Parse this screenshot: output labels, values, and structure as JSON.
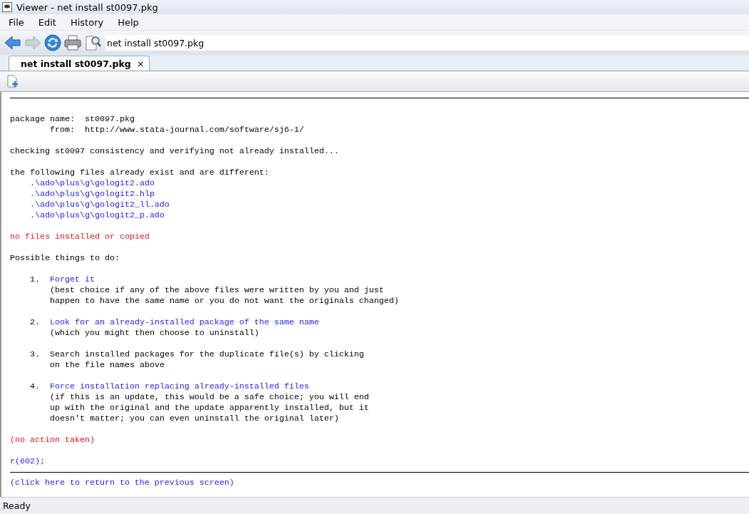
{
  "window": {
    "title": "Viewer - net install st0097.pkg"
  },
  "menu": [
    "File",
    "Edit",
    "History",
    "Help"
  ],
  "toolbar": {
    "address": "net install st0097.pkg"
  },
  "tabs": [
    {
      "label": "net install st0097.pkg",
      "selected": true,
      "close": "×"
    }
  ],
  "output": {
    "package": {
      "name_label": "package name:",
      "name": "st0097.pkg",
      "from_label": "from:",
      "from": "http://www.stata-journal.com/software/sj6-1/"
    },
    "checking": "checking st0097 consistency and verifying not already installed...",
    "conflict": {
      "heading": "the following files already exist and are different:",
      "files": [
        ".\\ado\\plus\\g\\gologit2.ado",
        ".\\ado\\plus\\g\\gologit2.hlp",
        ".\\ado\\plus\\g\\gologit2_ll.ado",
        ".\\ado\\plus\\g\\gologit2_p.ado"
      ]
    },
    "error": "no files installed or copied",
    "options": {
      "heading": "Possible things to do:",
      "items": [
        {
          "number": "1.",
          "kind": "link",
          "title": "Forget it",
          "notes": [
            "(best choice if any of the above files were written by you and just",
            "happen to have the same name or you do not want the originals changed)"
          ]
        },
        {
          "number": "2.",
          "kind": "link",
          "title": "Look for an already-installed package of the same name",
          "notes": [
            "(which you might then choose to uninstall)"
          ]
        },
        {
          "number": "3.",
          "kind": "text",
          "title": "Search installed packages for the duplicate file(s) by clicking",
          "notes": [
            "on the file names above"
          ]
        },
        {
          "number": "4.",
          "kind": "link",
          "title": "Force installation replacing already-installed files",
          "notes": [
            "(if this is an update, this would be a safe choice; you will end",
            "up with the original and the update apparently installed, but it",
            "doesn't matter; you can even uninstall the original later)"
          ]
        }
      ]
    },
    "no_action": "(no action taken)",
    "return_code": "r(602);",
    "back_link": "(click here to return to the previous screen)"
  },
  "status_bar": "Ready"
}
